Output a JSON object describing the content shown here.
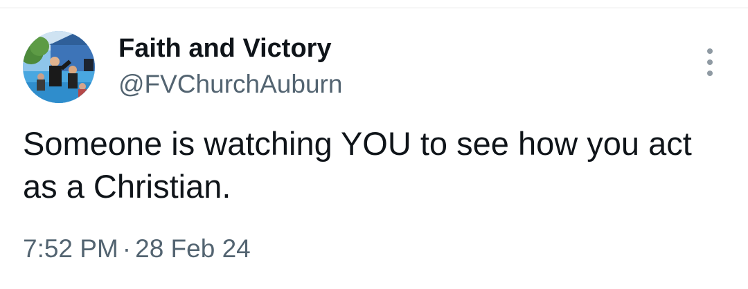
{
  "author": {
    "display_name": "Faith and Victory",
    "handle": "@FVChurchAuburn",
    "avatar": "profile-photo"
  },
  "tweet": {
    "text": "Someone is watching YOU to see how you act as a Christian.",
    "time": "7:52 PM",
    "separator": "·",
    "date": "28 Feb 24"
  },
  "icons": {
    "more": "more-vertical-icon"
  },
  "colors": {
    "primary_text": "#0f1419",
    "secondary_text": "#536471",
    "more_icon": "#8f9aa3"
  }
}
